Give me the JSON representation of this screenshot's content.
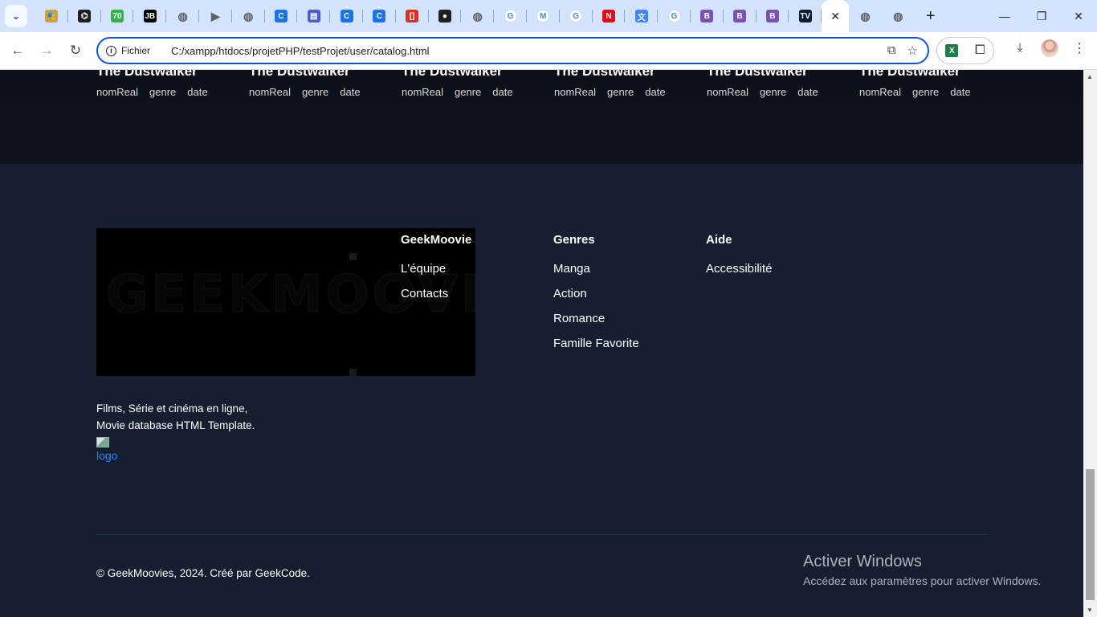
{
  "browser": {
    "tabs": [
      {
        "icon": "mask-icon",
        "color": "#c7a24a",
        "glyph": "🎭"
      },
      {
        "icon": "openai-icon",
        "color": "#1f1f1f",
        "glyph": "⌬"
      },
      {
        "icon": "green-70-icon",
        "color": "#2fb34a",
        "glyph": "70"
      },
      {
        "icon": "jetbrains-icon",
        "color": "#000000",
        "glyph": "JB"
      },
      {
        "icon": "globe-icon",
        "color": "#5f6368",
        "glyph": "◍"
      },
      {
        "icon": "youtube-icon",
        "color": "#5f6368",
        "glyph": "▶"
      },
      {
        "icon": "globe-icon",
        "color": "#5f6368",
        "glyph": "◍"
      },
      {
        "icon": "copilot-icon",
        "color": "#1a73e8",
        "glyph": "C"
      },
      {
        "icon": "printer-icon",
        "color": "#4a5bd8",
        "glyph": "▤"
      },
      {
        "icon": "copilot-icon",
        "color": "#1a73e8",
        "glyph": "C"
      },
      {
        "icon": "copilot-icon",
        "color": "#1a73e8",
        "glyph": "C"
      },
      {
        "icon": "red-bracket-icon",
        "color": "#d93025",
        "glyph": "[]"
      },
      {
        "icon": "github-icon",
        "color": "#1f1f1f",
        "glyph": "●"
      },
      {
        "icon": "globe-icon",
        "color": "#5f6368",
        "glyph": "◍"
      },
      {
        "icon": "google-icon",
        "color": "#ffffff",
        "glyph": "G"
      },
      {
        "icon": "gmail-icon",
        "color": "#ffffff",
        "glyph": "M"
      },
      {
        "icon": "google-icon",
        "color": "#ffffff",
        "glyph": "G"
      },
      {
        "icon": "netflix-icon",
        "color": "#e50914",
        "glyph": "N"
      },
      {
        "icon": "translate-icon",
        "color": "#4285f4",
        "glyph": "文"
      },
      {
        "icon": "google-icon",
        "color": "#ffffff",
        "glyph": "G"
      },
      {
        "icon": "bootstrap-icon",
        "color": "#7952b3",
        "glyph": "B"
      },
      {
        "icon": "bootstrap-icon",
        "color": "#7952b3",
        "glyph": "B"
      },
      {
        "icon": "bootstrap-icon",
        "color": "#7952b3",
        "glyph": "B"
      },
      {
        "icon": "tv-icon",
        "color": "#0f1e33",
        "glyph": "TV"
      }
    ],
    "after_tabs": [
      {
        "icon": "globe-icon",
        "color": "#5f6368",
        "glyph": "◍"
      },
      {
        "icon": "globe-icon",
        "color": "#5f6368",
        "glyph": "◍"
      }
    ],
    "omnibox": {
      "security_label": "Fichier",
      "url": "C:/xampp/htdocs/projetPHP/testProjet/user/catalog.html"
    }
  },
  "catalog": {
    "cards": [
      {
        "title": "The Dustwalker",
        "real": "nomReal",
        "genre": "genre",
        "date": "date"
      },
      {
        "title": "The Dustwalker",
        "real": "nomReal",
        "genre": "genre",
        "date": "date"
      },
      {
        "title": "The Dustwalker",
        "real": "nomReal",
        "genre": "genre",
        "date": "date"
      },
      {
        "title": "The Dustwalker",
        "real": "nomReal",
        "genre": "genre",
        "date": "date"
      },
      {
        "title": "The Dustwalker",
        "real": "nomReal",
        "genre": "genre",
        "date": "date"
      },
      {
        "title": "The Dustwalker",
        "real": "nomReal",
        "genre": "genre",
        "date": "date"
      }
    ]
  },
  "footer": {
    "logo_text": "GEEKMOOVIE",
    "columns": [
      {
        "title": "GeekMoovie",
        "links": [
          "L'équipe",
          "Contacts"
        ]
      },
      {
        "title": "Genres",
        "links": [
          "Manga",
          "Action",
          "Romance",
          "Famille Favorite"
        ]
      },
      {
        "title": "Aide",
        "links": [
          "Accessibilité"
        ]
      }
    ],
    "tagline_line1": "Films, Série et cinéma en ligne,",
    "tagline_line2": "Movie database HTML Template.",
    "broken_image_alt": "logo",
    "copyright_prefix": "© GeekMoovies, 2024. Créé par ",
    "copyright_link": "GeekCode",
    "copyright_suffix": "."
  },
  "windows_watermark": {
    "title": "Activer Windows",
    "subtitle": "Accédez aux paramètres pour activer Windows."
  }
}
